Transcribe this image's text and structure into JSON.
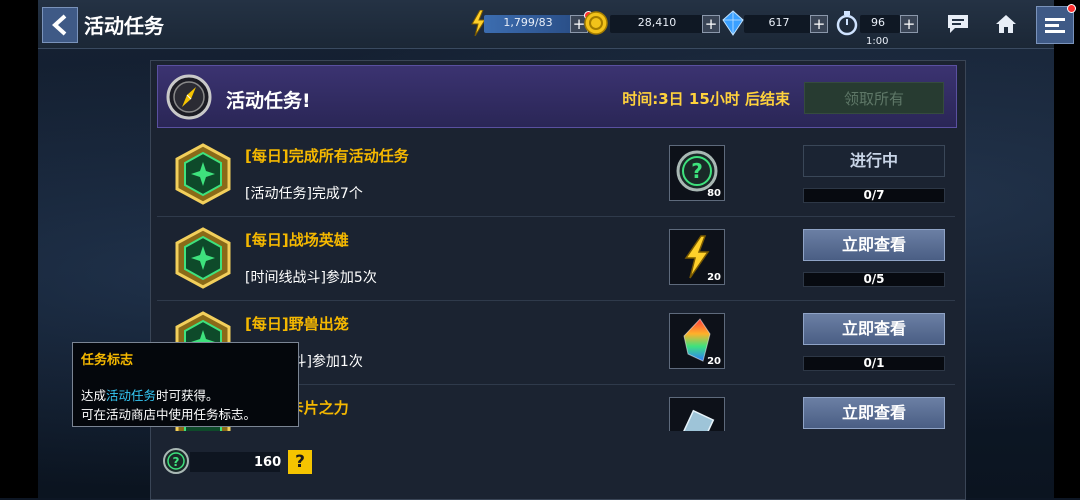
{
  "topbar": {
    "title": "活动任务",
    "energy": "1,799/83",
    "gold": "28,410",
    "crystal": "617",
    "timer_count": "96",
    "timer_time": "1:00"
  },
  "event": {
    "title": "活动任务!",
    "time_text": "时间:3日 15小时 后结束",
    "claim_all_label": "领取所有"
  },
  "tasks": [
    {
      "title": "[每日]完成所有活动任务",
      "desc": "[活动任务]完成7个",
      "reward_icon": "token-question-icon",
      "reward_count": "80",
      "action_label": "进行中",
      "progress": "0/7"
    },
    {
      "title": "[每日]战场英雄",
      "desc": "[时间线战斗]参加5次",
      "reward_icon": "lightning-energy-icon",
      "reward_count": "20",
      "action_label": "立即查看",
      "progress": "0/5"
    },
    {
      "title": "[每日]野兽出笼",
      "desc": "[联盟战斗]参加1次",
      "reward_icon": "rainbow-crystal-icon",
      "reward_count": "20",
      "action_label": "立即查看",
      "progress": "0/1"
    },
    {
      "title": "[每日]卡片之力",
      "desc": "",
      "reward_icon": "card-pack-icon",
      "reward_count": "",
      "action_label": "立即查看",
      "progress": ""
    }
  ],
  "tooltip": {
    "title": "任务标志",
    "line1_prefix": "达成",
    "line1_highlight": "活动任务",
    "line1_suffix": "时可获得。",
    "line2": "可在活动商店中使用任务标志。"
  },
  "footer": {
    "token_count": "160",
    "help_label": "?"
  },
  "colors": {
    "accent_gold": "#f5b800",
    "highlight_blue": "#35c8f5",
    "header_purple": "#3b3371"
  }
}
